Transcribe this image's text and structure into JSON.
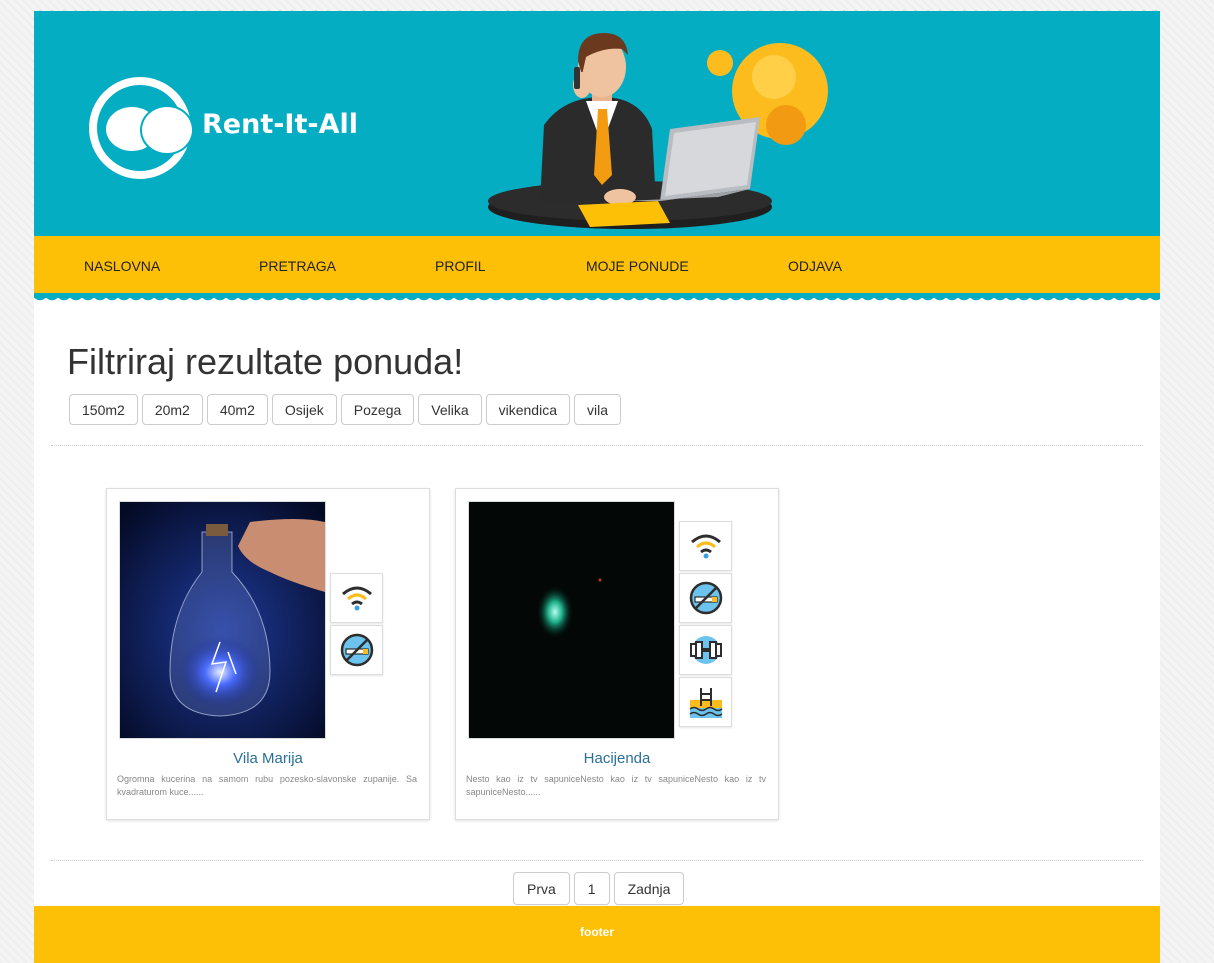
{
  "header": {
    "brand": "Rent-It-All"
  },
  "nav": {
    "items": [
      {
        "label": "NASLOVNA"
      },
      {
        "label": "PRETRAGA"
      },
      {
        "label": "PROFIL"
      },
      {
        "label": "MOJE PONUDE"
      },
      {
        "label": "ODJAVA"
      }
    ]
  },
  "filter": {
    "title": "Filtriraj rezultate ponuda!",
    "tags": [
      "150m2",
      "20m2",
      "40m2",
      "Osijek",
      "Pozega",
      "Velika",
      "vikendica",
      "vila"
    ]
  },
  "listings": [
    {
      "title": "Vila Marija",
      "description": "Ogromna kucerina na samom rubu pozesko-slavonske zupanije. Sa kvadraturom kuce......",
      "amenities": [
        "wifi-icon",
        "no-smoking-icon"
      ]
    },
    {
      "title": "Hacijenda",
      "description": "Nesto kao iz tv sapuniceNesto kao iz tv sapuniceNesto kao iz tv sapuniceNesto......",
      "amenities": [
        "wifi-icon",
        "no-smoking-icon",
        "gym-icon",
        "pool-icon"
      ]
    }
  ],
  "pagination": {
    "first": "Prva",
    "current": "1",
    "last": "Zadnja"
  },
  "footer": {
    "text": "footer"
  },
  "colors": {
    "header_teal": "#04adc2",
    "nav_yellow": "#fec006",
    "link_blue": "#2a6f97"
  }
}
